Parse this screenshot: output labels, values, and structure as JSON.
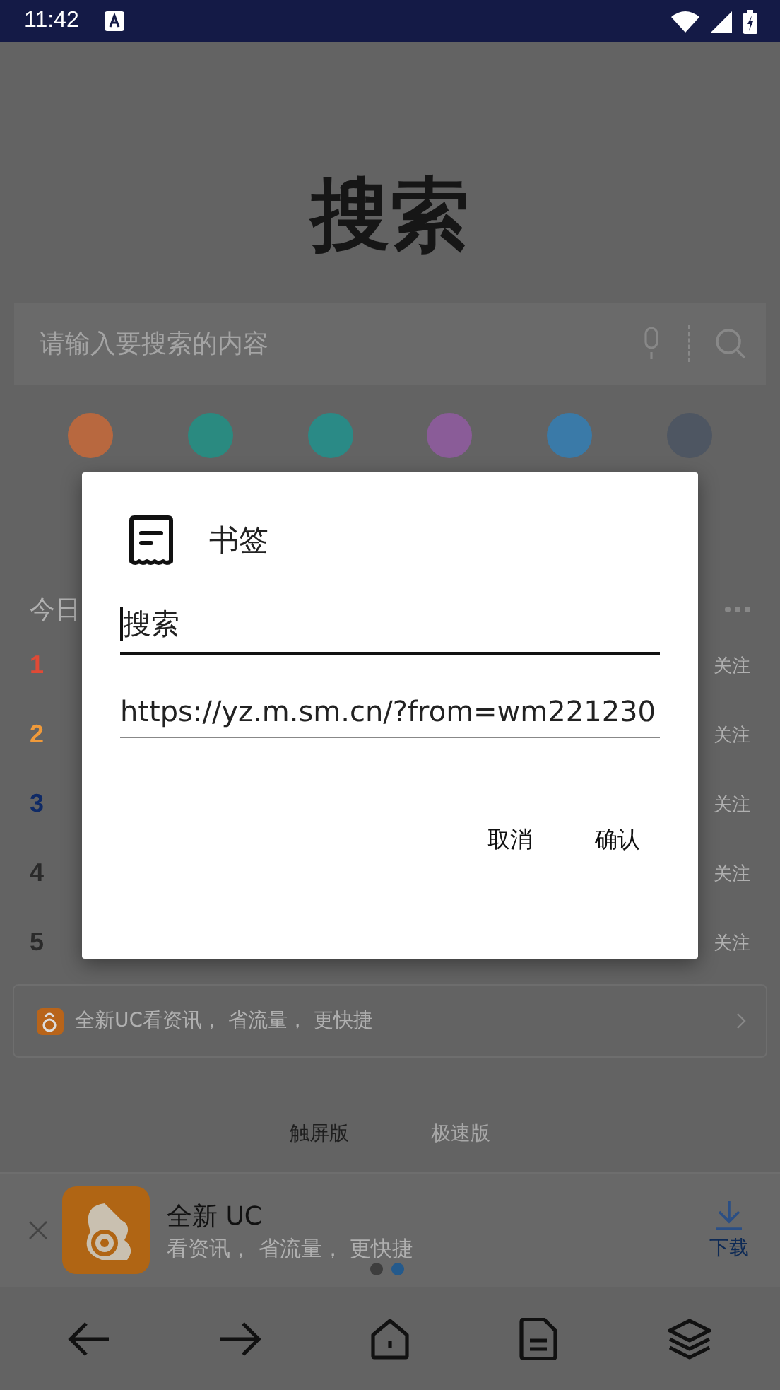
{
  "status_bar": {
    "time": "11:42"
  },
  "page": {
    "title": "搜索",
    "search": {
      "placeholder": "请输入要搜索的内容"
    },
    "shortcuts": [
      {
        "color": "#b8683f"
      },
      {
        "color": "#2a8a80"
      },
      {
        "color": "#2a8a86"
      },
      {
        "color": "#8a5c98"
      },
      {
        "color": "#3a7aa8"
      },
      {
        "color": "#4e5662"
      }
    ],
    "hot_section": {
      "title": "今日",
      "items": [
        {
          "rank": "1",
          "color": "#e04a36",
          "action": "关注"
        },
        {
          "rank": "2",
          "color": "#f09a3a",
          "action": "关注"
        },
        {
          "rank": "3",
          "color": "#0f2a66",
          "action": "关注"
        },
        {
          "rank": "4",
          "color": "#2a2a2a",
          "action": "关注"
        },
        {
          "rank": "5",
          "color": "#2a2a2a",
          "action": "关注"
        }
      ]
    },
    "banner": {
      "text": "全新UC看资讯， 省流量， 更快捷"
    },
    "version_tabs": [
      {
        "label": "触屏版",
        "selected": true
      },
      {
        "label": "极速版",
        "selected": false
      }
    ],
    "promo": {
      "title": "全新 UC",
      "subtitle": "看资讯， 省流量， 更快捷",
      "download": "下载",
      "dots": [
        {
          "selected": false
        },
        {
          "selected": true
        }
      ]
    }
  },
  "dialog": {
    "title": "书签",
    "fields": [
      {
        "value": "搜索",
        "focused": true
      },
      {
        "value": "https://yz.m.sm.cn/?from=wm221230",
        "focused": false
      }
    ],
    "buttons": [
      "取消",
      "确认"
    ]
  }
}
